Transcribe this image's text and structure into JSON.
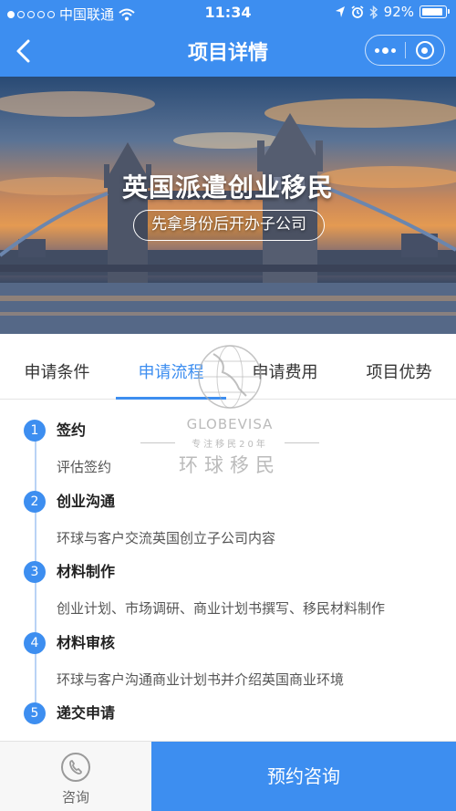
{
  "status_bar": {
    "carrier": "中国联通",
    "time": "11:34",
    "battery": "92%"
  },
  "nav": {
    "title": "项目详情"
  },
  "banner": {
    "title": "英国派遣创业移民",
    "subtitle": "先拿身份后开办子公司"
  },
  "tabs": [
    {
      "label": "申请条件",
      "active": false
    },
    {
      "label": "申请流程",
      "active": true
    },
    {
      "label": "申请费用",
      "active": false
    },
    {
      "label": "项目优势",
      "active": false
    }
  ],
  "steps": [
    {
      "num": "1",
      "title": "签约",
      "desc": "评估签约"
    },
    {
      "num": "2",
      "title": "创业沟通",
      "desc": "环球与客户交流英国创立子公司内容"
    },
    {
      "num": "3",
      "title": "材料制作",
      "desc": "创业计划、市场调研、商业计划书撰写、移民材料制作"
    },
    {
      "num": "4",
      "title": "材料审核",
      "desc": "环球与客户沟通商业计划书并介绍英国商业环境"
    },
    {
      "num": "5",
      "title": "递交申请",
      "desc": ""
    }
  ],
  "watermark": {
    "english": "GLOBEVISA",
    "tagline": "专注移民20年",
    "chinese": "环球移民"
  },
  "bottom": {
    "consult_label": "咨询",
    "book_label": "预约咨询"
  },
  "colors": {
    "accent": "#3d8ef0",
    "timeline_line": "#b9d3f5"
  }
}
